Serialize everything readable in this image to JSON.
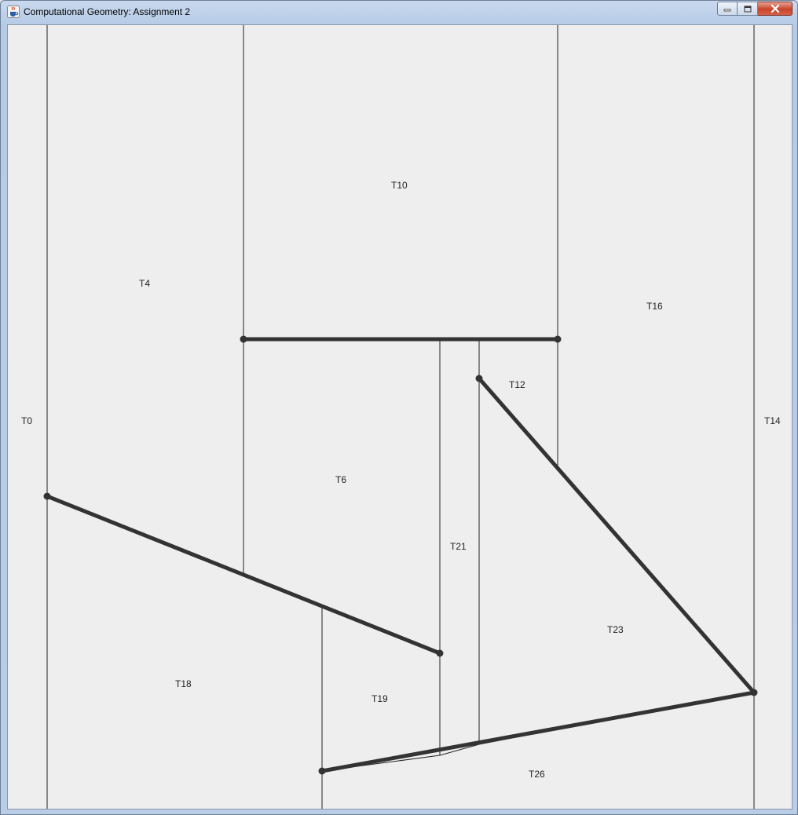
{
  "window": {
    "title": "Computational Geometry: Assignment 2",
    "icon": "java-cup-icon",
    "controls": [
      "minimize-icon",
      "maximize-icon",
      "close-icon"
    ]
  },
  "colors": {
    "canvas_background": "#eeeeee",
    "segment": "#333333",
    "wall": "#222222",
    "close_button": "#c8442a"
  },
  "trapezoid_labels": [
    "T0",
    "T4",
    "T6",
    "T10",
    "T12",
    "T14",
    "T16",
    "T18",
    "T19",
    "T21",
    "T23",
    "T26"
  ]
}
